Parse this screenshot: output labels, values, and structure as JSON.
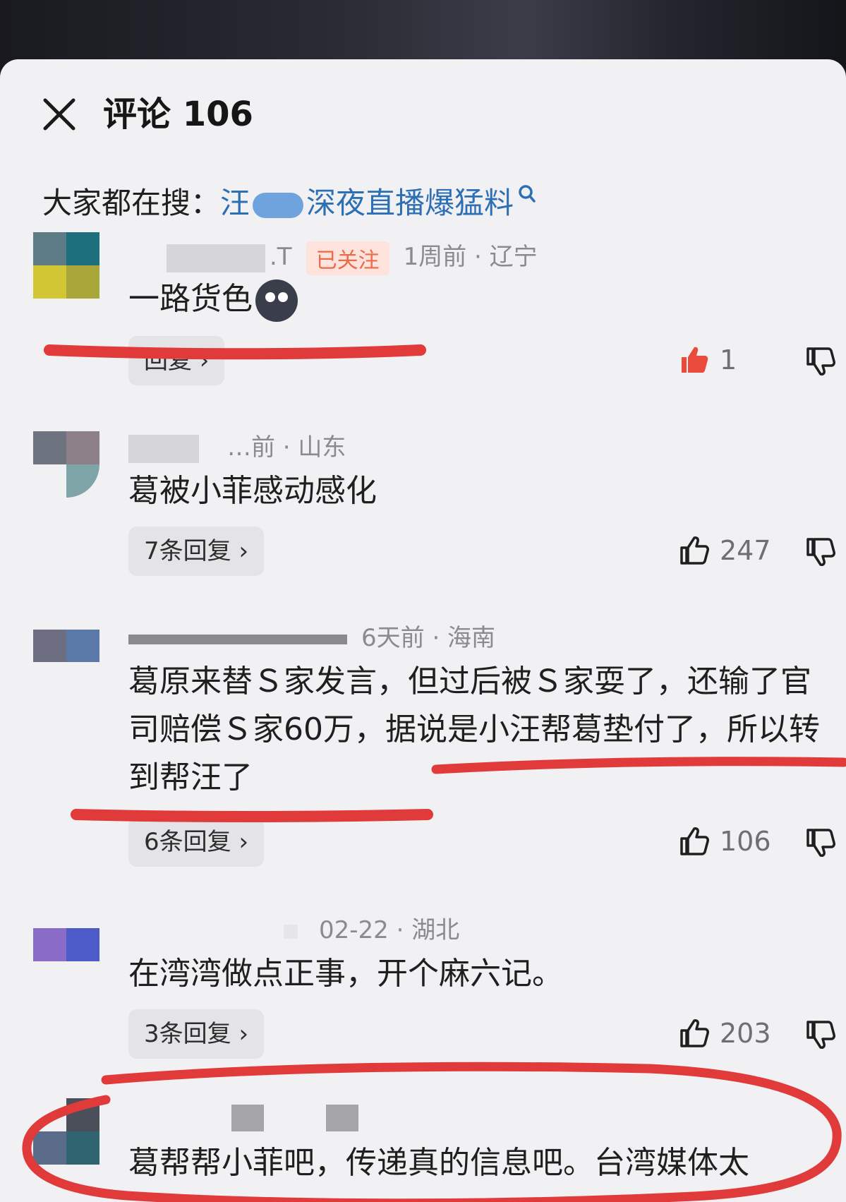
{
  "header": {
    "title": "评论 106"
  },
  "search": {
    "prefix": "大家都在搜：",
    "link_start": "汪",
    "link_rest": "深夜直播爆猛料"
  },
  "comments": [
    {
      "name_tail": ".T",
      "badge": "已关注",
      "time_loc": "1周前 · 辽宁",
      "text": "一路货色",
      "reply_label": "回复 ›",
      "likes": "1",
      "liked": true
    },
    {
      "time_loc": "…前 · 山东",
      "text": "葛被小菲感动感化",
      "reply_label": "7条回复 ›",
      "likes": "247"
    },
    {
      "time_loc": "6天前 · 海南",
      "text": "葛原来替Ｓ家发言，但过后被Ｓ家耍了，还输了官司赔偿Ｓ家60万，据说是小汪帮葛垫付了，所以转到帮汪了",
      "reply_label": "6条回复 ›",
      "likes": "106"
    },
    {
      "time_loc": "02-22 · 湖北",
      "text": "在湾湾做点正事，开个麻六记。",
      "reply_label": "3条回复 ›",
      "likes": "203"
    },
    {
      "text": "葛帮帮小菲吧，传递真的信息吧。台湾媒体太"
    }
  ],
  "colors": {
    "accent_red": "#e03a3a",
    "link_blue": "#2d6fb5",
    "like_red": "#e94a3c"
  }
}
